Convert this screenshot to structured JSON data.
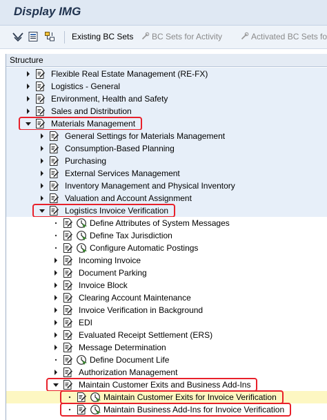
{
  "window": {
    "title": "Display IMG"
  },
  "toolbar": {
    "buttons": [
      {
        "label": "Existing BC Sets",
        "enabled": true
      },
      {
        "label": "BC Sets for Activity",
        "enabled": false
      },
      {
        "label": "Activated BC Sets fo",
        "enabled": false
      }
    ]
  },
  "structure": {
    "header": "Structure",
    "rows": [
      {
        "label": "Flexible Real Estate Management (RE-FX)",
        "level": 0,
        "expander": "collapsed",
        "clock": false,
        "bg": "blue"
      },
      {
        "label": "Logistics - General",
        "level": 0,
        "expander": "collapsed",
        "clock": false,
        "bg": "blue"
      },
      {
        "label": "Environment, Health and Safety",
        "level": 0,
        "expander": "collapsed",
        "clock": false,
        "bg": "blue"
      },
      {
        "label": "Sales and Distribution",
        "level": 0,
        "expander": "collapsed",
        "clock": false,
        "bg": "blue"
      },
      {
        "label": "Materials Management",
        "level": 0,
        "expander": "expanded",
        "clock": false,
        "bg": "blue",
        "highlight": true
      },
      {
        "label": "General Settings for Materials Management",
        "level": 1,
        "expander": "collapsed",
        "clock": false,
        "bg": "blue"
      },
      {
        "label": "Consumption-Based Planning",
        "level": 1,
        "expander": "collapsed",
        "clock": false,
        "bg": "blue"
      },
      {
        "label": "Purchasing",
        "level": 1,
        "expander": "collapsed",
        "clock": false,
        "bg": "blue"
      },
      {
        "label": "External Services Management",
        "level": 1,
        "expander": "collapsed",
        "clock": false,
        "bg": "blue"
      },
      {
        "label": "Inventory Management and Physical Inventory",
        "level": 1,
        "expander": "collapsed",
        "clock": false,
        "bg": "blue"
      },
      {
        "label": "Valuation and Account Assignment",
        "level": 1,
        "expander": "collapsed",
        "clock": false,
        "bg": "blue"
      },
      {
        "label": "Logistics Invoice Verification",
        "level": 1,
        "expander": "expanded",
        "clock": false,
        "bg": "blue",
        "highlight": true
      },
      {
        "label": "Define Attributes of System Messages",
        "level": 2,
        "expander": "leaf",
        "clock": true,
        "bg": "white"
      },
      {
        "label": "Define Tax Jurisdiction",
        "level": 2,
        "expander": "leaf",
        "clock": true,
        "bg": "white"
      },
      {
        "label": "Configure Automatic Postings",
        "level": 2,
        "expander": "leaf",
        "clock": true,
        "bg": "white"
      },
      {
        "label": "Incoming Invoice",
        "level": 2,
        "expander": "collapsed",
        "clock": false,
        "bg": "white"
      },
      {
        "label": "Document Parking",
        "level": 2,
        "expander": "collapsed",
        "clock": false,
        "bg": "white"
      },
      {
        "label": "Invoice Block",
        "level": 2,
        "expander": "collapsed",
        "clock": false,
        "bg": "white"
      },
      {
        "label": "Clearing Account Maintenance",
        "level": 2,
        "expander": "collapsed",
        "clock": false,
        "bg": "white"
      },
      {
        "label": "Invoice Verification in Background",
        "level": 2,
        "expander": "collapsed",
        "clock": false,
        "bg": "white"
      },
      {
        "label": "EDI",
        "level": 2,
        "expander": "collapsed",
        "clock": false,
        "bg": "white"
      },
      {
        "label": "Evaluated Receipt Settlement (ERS)",
        "level": 2,
        "expander": "collapsed",
        "clock": false,
        "bg": "white"
      },
      {
        "label": "Message Determination",
        "level": 2,
        "expander": "collapsed",
        "clock": false,
        "bg": "white"
      },
      {
        "label": "Define Document Life",
        "level": 2,
        "expander": "leaf",
        "clock": true,
        "bg": "white"
      },
      {
        "label": "Authorization Management",
        "level": 2,
        "expander": "collapsed",
        "clock": false,
        "bg": "white"
      },
      {
        "label": "Maintain Customer Exits and Business Add-Ins",
        "level": 2,
        "expander": "expanded",
        "clock": false,
        "bg": "white",
        "highlight": true
      },
      {
        "label": "Maintain Customer Exits for Invoice Verification",
        "level": 3,
        "expander": "leaf",
        "clock": true,
        "bg": "yellow",
        "highlight": true
      },
      {
        "label": "Maintain Business Add-Ins for Invoice Verification",
        "level": 3,
        "expander": "leaf",
        "clock": true,
        "bg": "white",
        "highlight": true
      }
    ]
  }
}
